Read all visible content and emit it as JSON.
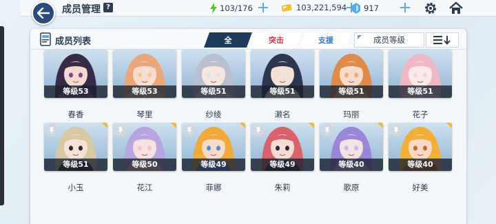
{
  "header": {
    "title": "成员管理",
    "help_label": "?",
    "stamina": "103/176",
    "credits": "103,221,594",
    "gems": "917"
  },
  "panel": {
    "title": "成员列表",
    "tabs": [
      {
        "label": "全",
        "active": true
      },
      {
        "label": "突击",
        "active": false
      },
      {
        "label": "支援",
        "active": false
      }
    ],
    "sort_label": "成员等级"
  },
  "members": [
    {
      "level": "等级53",
      "name": "春香",
      "art": [
        "#3a2a4a",
        "#7a4a86",
        "#f3d9d0"
      ]
    },
    {
      "level": "等级53",
      "name": "琴里",
      "art": [
        "#e9a77a",
        "#f4c9a1",
        "#f7ddd0"
      ]
    },
    {
      "level": "等级51",
      "name": "纱绫",
      "art": [
        "#b9bfcf",
        "#dde2ea",
        "#f6e6df"
      ]
    },
    {
      "level": "等级51",
      "name": "濑名",
      "art": [
        "#2c3650",
        "#e8e2d2",
        "#f4e1d5"
      ]
    },
    {
      "level": "等级51",
      "name": "玛丽",
      "art": [
        "#e08a4a",
        "#f3b073",
        "#f6dccd"
      ]
    },
    {
      "level": "等级51",
      "name": "花子",
      "art": [
        "#f0b7c4",
        "#f7d5dd",
        "#faeae8"
      ]
    },
    {
      "level": "等级51",
      "name": "小玉",
      "art": [
        "#d8c8a4",
        "#2b2b30",
        "#f4e2d6"
      ]
    },
    {
      "level": "等级50",
      "name": "花江",
      "art": [
        "#b8a4e0",
        "#f2c0d3",
        "#f6e3df"
      ]
    },
    {
      "level": "等级49",
      "name": "菲娜",
      "art": [
        "#f0a93a",
        "#4a8fd6",
        "#f6dcc8"
      ]
    },
    {
      "level": "等级49",
      "name": "朱莉",
      "art": [
        "#d9626c",
        "#2b2b38",
        "#f6dcd5"
      ]
    },
    {
      "level": "等级40",
      "name": "歌原",
      "art": [
        "#9a86d8",
        "#c7b8ee",
        "#f4e3e0"
      ]
    },
    {
      "level": "等级40",
      "name": "好美",
      "art": [
        "#f0b038",
        "#c86a2a",
        "#f6dac6"
      ]
    }
  ],
  "colors": {
    "accent_dark": "#1f3b5c",
    "attack_red": "#d6364a",
    "support_blue": "#2f7fd1",
    "stamina_green": "#5bc236",
    "credit_gold": "#f2c335",
    "gem_blue": "#5fa8e6"
  },
  "icons": [
    "back-arrow-icon",
    "lightning-icon",
    "plus-icon",
    "coin-icon",
    "gem-icon",
    "gear-icon",
    "home-icon",
    "member-list-icon",
    "sort-order-icon",
    "pin-icon"
  ]
}
